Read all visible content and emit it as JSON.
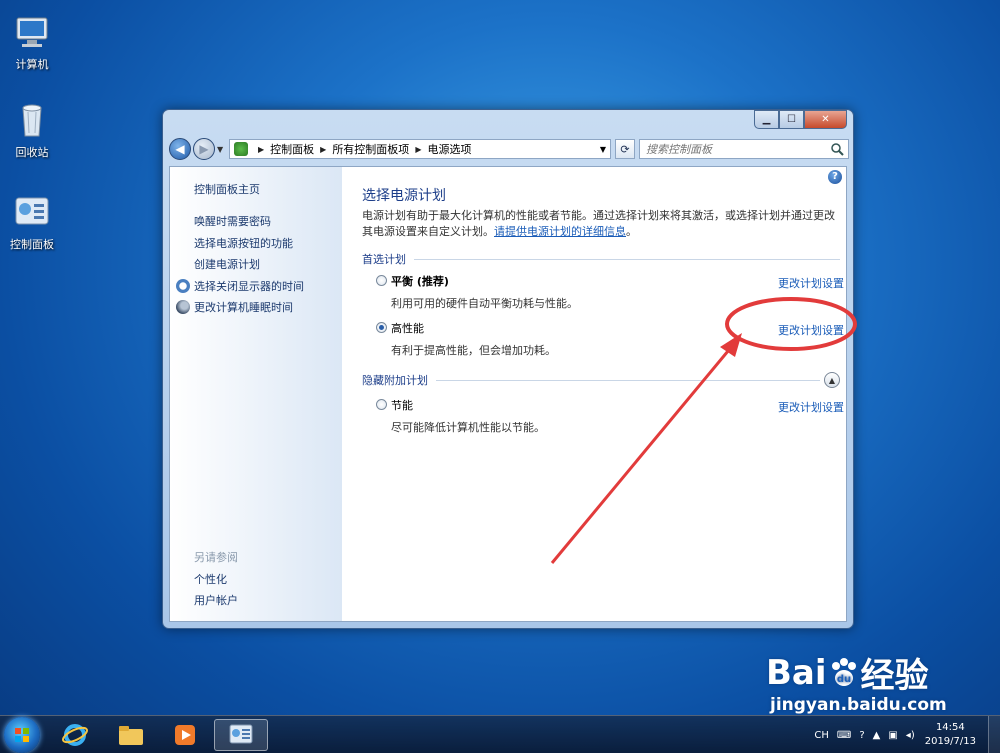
{
  "desktop": {
    "icons": [
      {
        "label": "计算机",
        "icon": "computer-icon"
      },
      {
        "label": "回收站",
        "icon": "recycle-bin-icon"
      },
      {
        "label": "控制面板",
        "icon": "control-panel-icon"
      }
    ]
  },
  "window": {
    "address": {
      "crumbs": [
        "控制面板",
        "所有控制面板项",
        "电源选项"
      ]
    },
    "search": {
      "placeholder": "搜索控制面板"
    },
    "left_pane": {
      "home": "控制面板主页",
      "links": [
        "唤醒时需要密码",
        "选择电源按钮的功能",
        "创建电源计划",
        "选择关闭显示器的时间",
        "更改计算机睡眠时间"
      ],
      "see_also_title": "另请参阅",
      "see_also": [
        "个性化",
        "用户帐户"
      ]
    },
    "main": {
      "title": "选择电源计划",
      "desc": "电源计划有助于最大化计算机的性能或者节能。通过选择计划来将其激活，或选择计划并通过更改其电源设置来自定义计划。",
      "desc_link": "请提供电源计划的详细信息",
      "preferred_label": "首选计划",
      "hidden_label": "隐藏附加计划",
      "plans": [
        {
          "name": "平衡 (推荐)",
          "desc": "利用可用的硬件自动平衡功耗与性能。",
          "link": "更改计划设置",
          "selected": false
        },
        {
          "name": "高性能",
          "desc": "有利于提高性能，但会增加功耗。",
          "link": "更改计划设置",
          "selected": true
        },
        {
          "name": "节能",
          "desc": "尽可能降低计算机性能以节能。",
          "link": "更改计划设置",
          "selected": false
        }
      ]
    }
  },
  "taskbar": {
    "lang": "CH",
    "time": "14:54",
    "date": "2019/7/13"
  },
  "watermark": {
    "brand": "Bai",
    "brand2": "du",
    "brand_cn": "经验",
    "url": "jingyan.baidu.com"
  },
  "colors": {
    "annotation": "#e23b3b",
    "link": "#1a5cb8",
    "title": "#1e3f8a"
  }
}
